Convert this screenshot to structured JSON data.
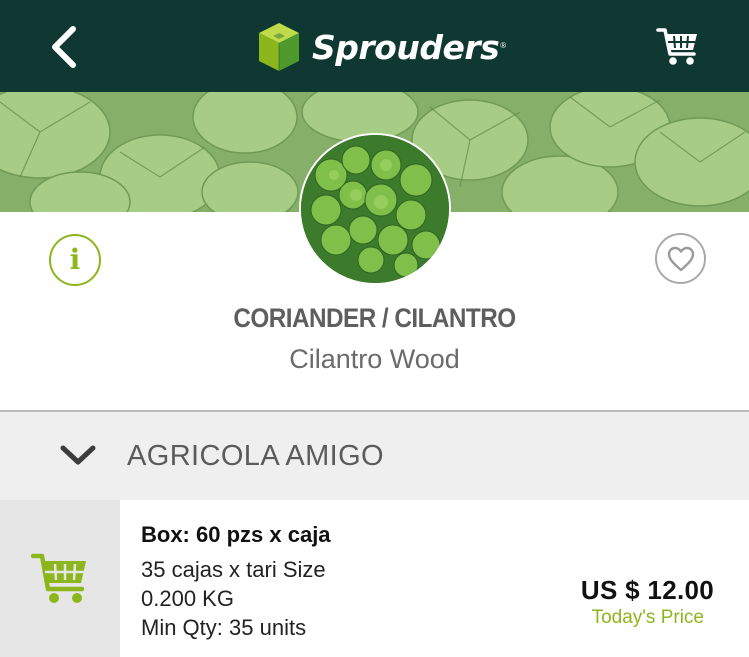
{
  "header": {
    "brand_name": "Sprouders",
    "brand_reg": "®",
    "back_icon": "chevron-left-icon",
    "cart_icon": "shopping-cart-icon"
  },
  "product": {
    "title": "CORIANDER / CILANTRO",
    "subtitle": "Cilantro Wood",
    "info_icon": "info-icon",
    "favorite_icon": "heart-icon"
  },
  "supplier": {
    "name": "AGRICOLA AMIGO",
    "expand_icon": "chevron-down-icon"
  },
  "offer": {
    "box": "Box: 60 pzs x caja",
    "line1": "35 cajas x tari Size",
    "line2": "0.200 KG",
    "line3": "Min Qty: 35 units",
    "price": "US $ 12.00",
    "price_label": "Today's Price",
    "cart_icon": "add-to-cart-icon"
  },
  "colors": {
    "header_bg": "#0e3831",
    "accent_green": "#8cb61c",
    "supplier_bg": "#efefef",
    "cart_cell_bg": "#e6e6e6"
  }
}
